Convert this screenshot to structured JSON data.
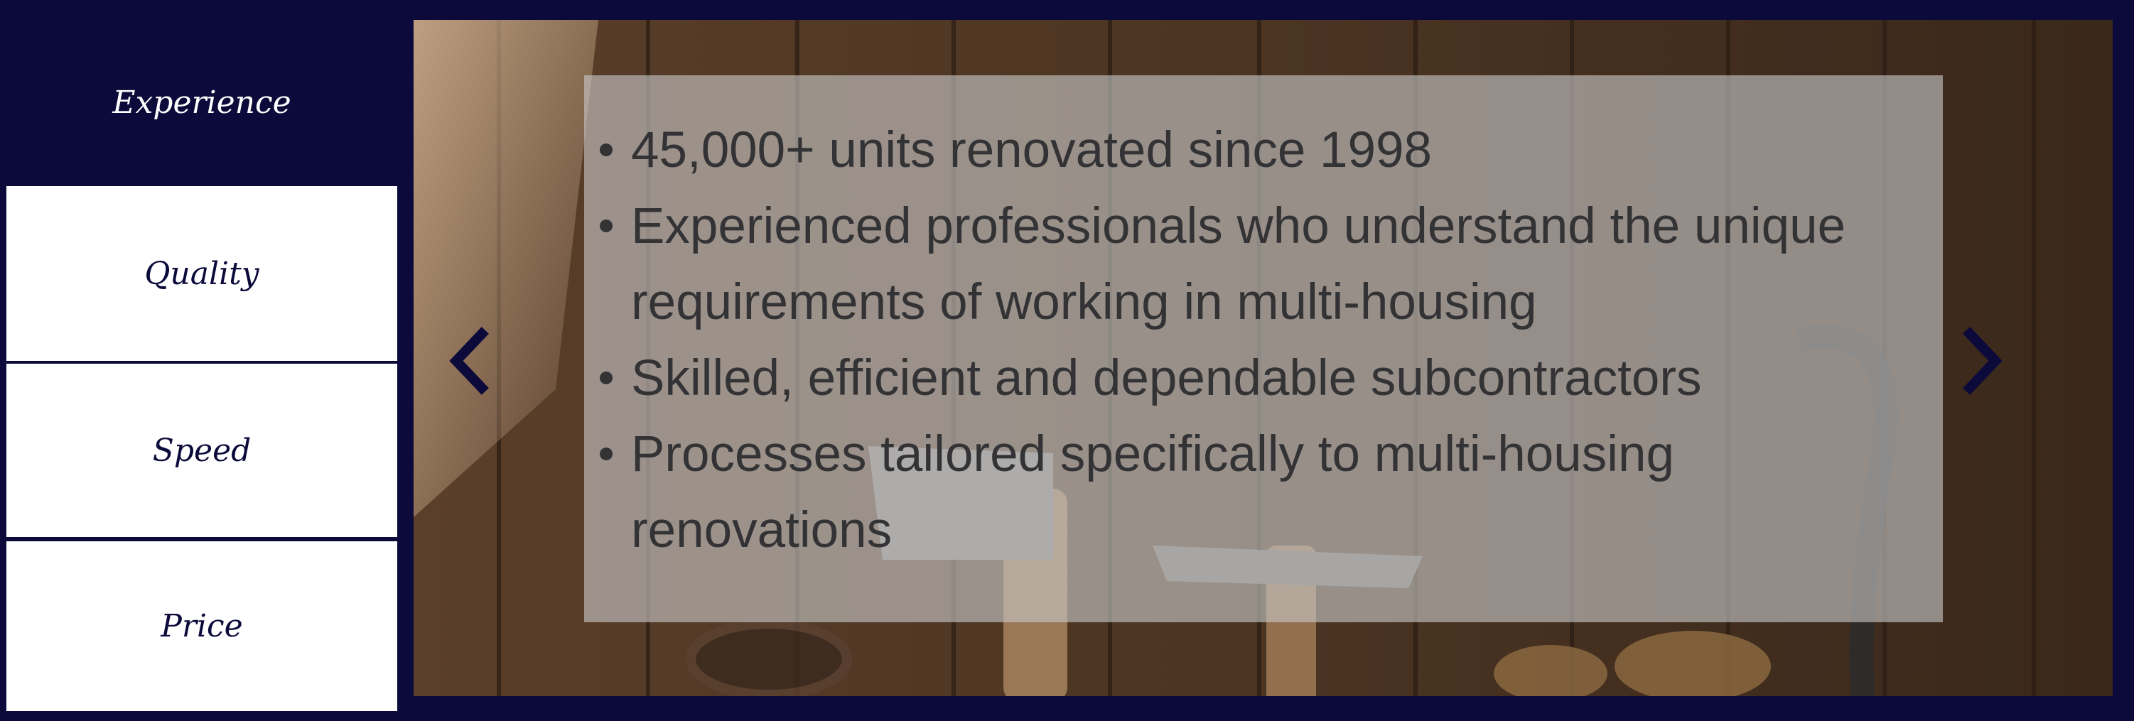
{
  "tabs": [
    {
      "label": "Experience",
      "active": true
    },
    {
      "label": "Quality",
      "active": false
    },
    {
      "label": "Speed",
      "active": false
    },
    {
      "label": "Price",
      "active": false
    }
  ],
  "slide": {
    "bullets": [
      "45,000+ units renovated since 1998",
      "Experienced professionals who understand the unique requirements of working in multi-housing",
      "Skilled, efficient and dependable subcontractors",
      "Processes tailored specifically to multi-housing renovations"
    ]
  },
  "icons": {
    "prev": "chevron-left-icon",
    "next": "chevron-right-icon"
  },
  "colors": {
    "navy": "#0b0a3a",
    "white": "#ffffff",
    "overlay_text": "#333336"
  }
}
